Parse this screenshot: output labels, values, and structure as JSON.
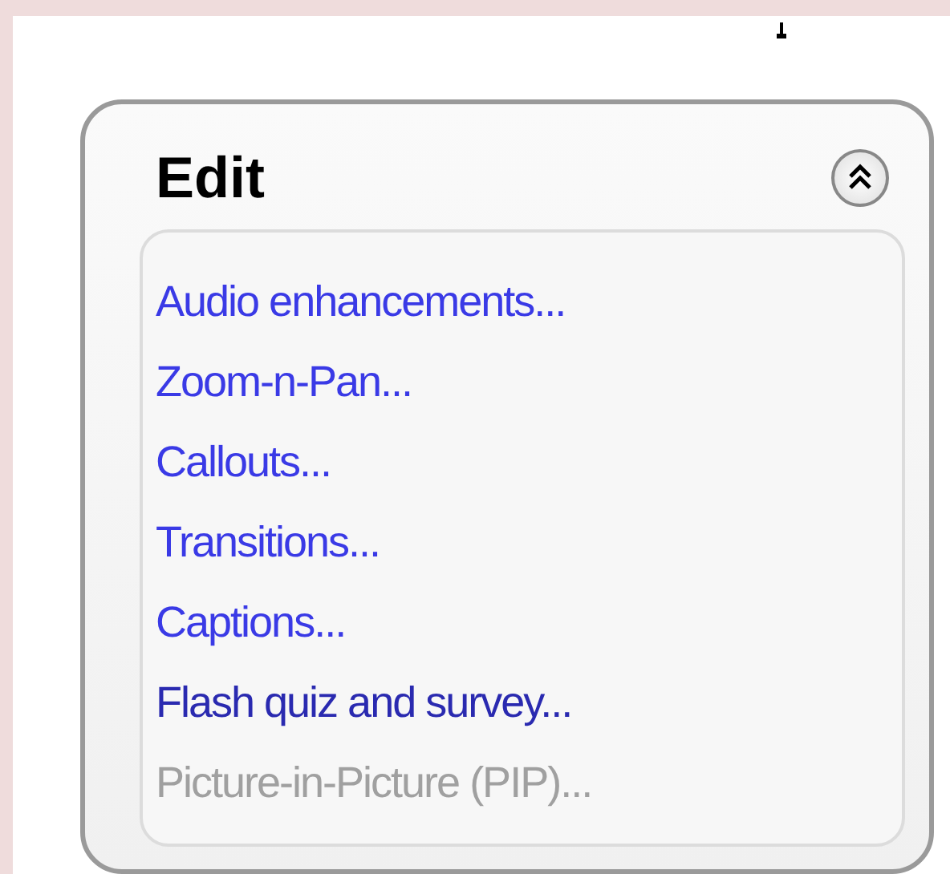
{
  "panel": {
    "title": "Edit",
    "expanded": true,
    "items": [
      {
        "label": "Audio enhancements...",
        "disabled": false,
        "visited": false
      },
      {
        "label": "Zoom-n-Pan...",
        "disabled": false,
        "visited": false
      },
      {
        "label": "Callouts...",
        "disabled": false,
        "visited": false
      },
      {
        "label": "Transitions...",
        "disabled": false,
        "visited": false
      },
      {
        "label": "Captions...",
        "disabled": false,
        "visited": false
      },
      {
        "label": "Flash quiz and survey...",
        "disabled": false,
        "visited": true
      },
      {
        "label": "Picture-in-Picture (PIP)...",
        "disabled": true,
        "visited": false
      }
    ]
  }
}
